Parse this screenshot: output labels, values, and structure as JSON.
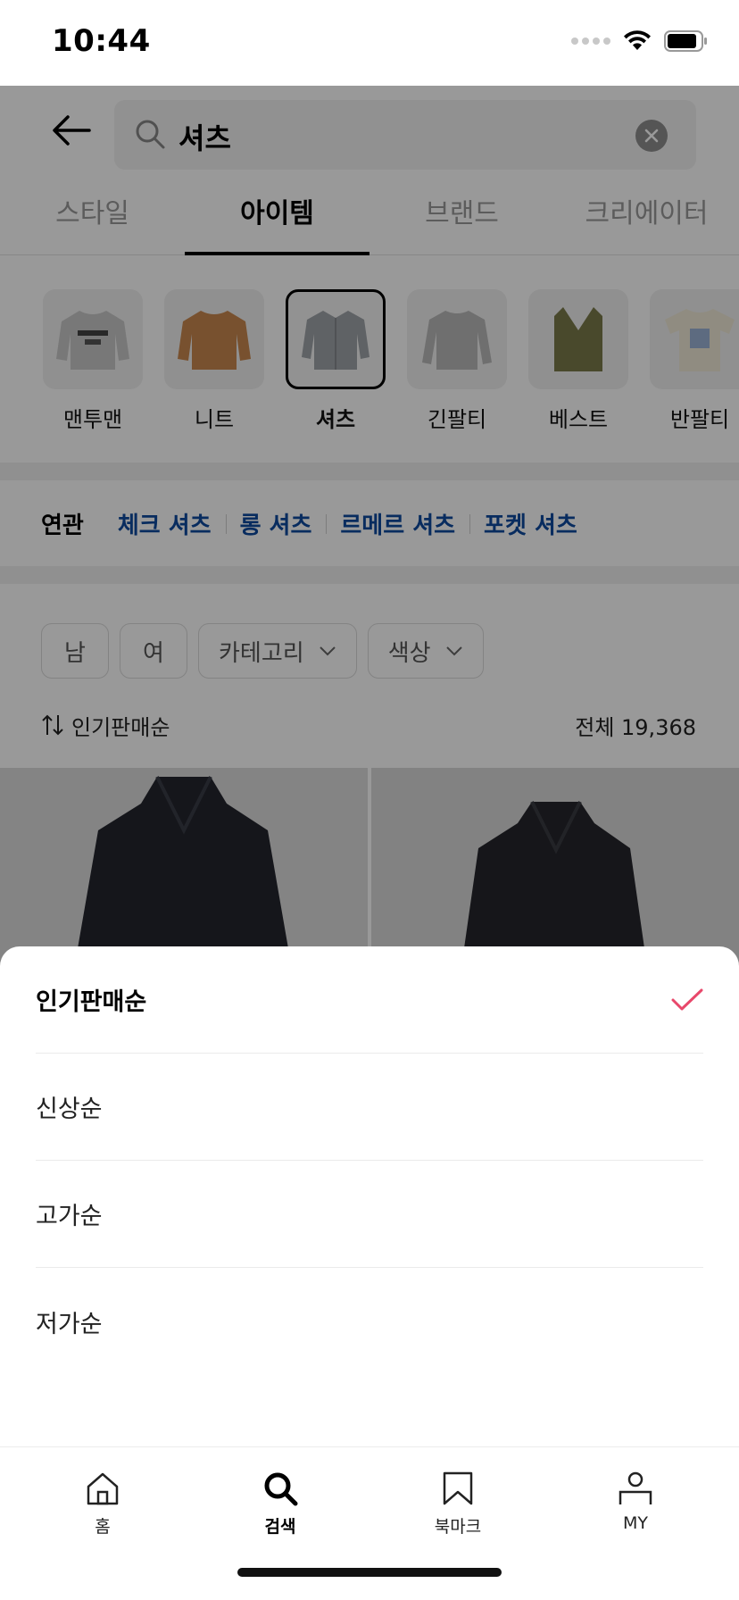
{
  "status_bar": {
    "time": "10:44"
  },
  "search": {
    "query": "셔츠"
  },
  "tabs": [
    {
      "label": "스타일",
      "active": false
    },
    {
      "label": "아이템",
      "active": true
    },
    {
      "label": "브랜드",
      "active": false
    },
    {
      "label": "크리에이터",
      "active": false
    }
  ],
  "categories": [
    {
      "label": "맨투맨",
      "active": false
    },
    {
      "label": "니트",
      "active": false
    },
    {
      "label": "셔츠",
      "active": true
    },
    {
      "label": "긴팔티",
      "active": false
    },
    {
      "label": "베스트",
      "active": false
    },
    {
      "label": "반팔티",
      "active": false
    }
  ],
  "related": {
    "title": "연관",
    "links": [
      "체크 셔츠",
      "롱 셔츠",
      "르메르 셔츠",
      "포켓 셔츠"
    ]
  },
  "filters": {
    "male": "남",
    "female": "여",
    "category": "카테고리",
    "color": "색상"
  },
  "sort": {
    "current": "인기판매순",
    "total": "전체 19,368"
  },
  "sort_sheet": {
    "options": [
      {
        "label": "인기판매순",
        "selected": true
      },
      {
        "label": "신상순",
        "selected": false
      },
      {
        "label": "고가순",
        "selected": false
      },
      {
        "label": "저가순",
        "selected": false
      }
    ],
    "accent_color": "#e8486b"
  },
  "bottom_nav": [
    {
      "label": "홈",
      "icon": "home-icon",
      "active": false
    },
    {
      "label": "검색",
      "icon": "search-icon",
      "active": true
    },
    {
      "label": "북마크",
      "icon": "bookmark-icon",
      "active": false
    },
    {
      "label": "MY",
      "icon": "person-icon",
      "active": false
    }
  ]
}
